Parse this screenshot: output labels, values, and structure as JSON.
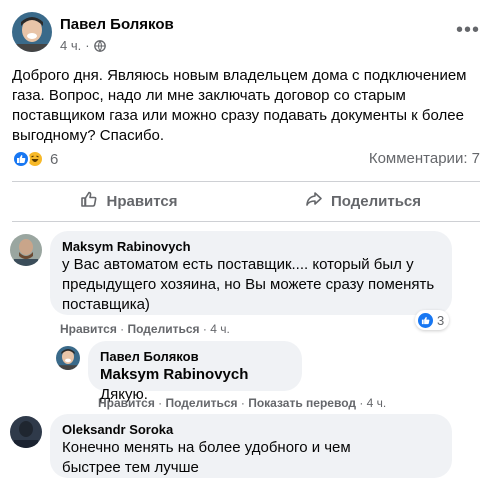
{
  "post": {
    "author": "Павел Боляков",
    "time": "4 ч.",
    "text": "Доброго дня. Являюсь новым владельцем дома с подключением газа. Вопрос, надо ли мне заключать договор со старым поставщиком газа или можно сразу подавать документы к более выгодному? Спасибо.",
    "reactions_count": "6",
    "comments_count": "Комментарии: 7"
  },
  "actions": {
    "like": "Нравится",
    "share": "Поделиться"
  },
  "comments": [
    {
      "author": "Maksym Rabinovych",
      "text": "у Вас автоматом есть поставщик.... который был у предыдущего хозяина, но Вы можете сразу поменять поставщика)",
      "like": "Нравится",
      "share": "Поделиться",
      "time": "4 ч.",
      "reactions": "3"
    },
    {
      "author": "Павел Боляков",
      "mention": "Maksym Rabinovych",
      "text": "Дякую.",
      "like": "Нравится",
      "share": "Поделиться",
      "translate": "Показать перевод",
      "time": "4 ч."
    },
    {
      "author": "Oleksandr Soroka",
      "text": "Конечно менять на более удобного и чем быстрее тем лучше"
    }
  ],
  "colors": {
    "accent": "#1877f2",
    "secondary_text": "#65676b",
    "bubble": "#f0f2f5",
    "haha": "#f7b928"
  },
  "icons": [
    "globe-icon",
    "more-icon",
    "like-icon",
    "haha-icon",
    "thumbs-up-icon",
    "share-arrow-icon"
  ]
}
